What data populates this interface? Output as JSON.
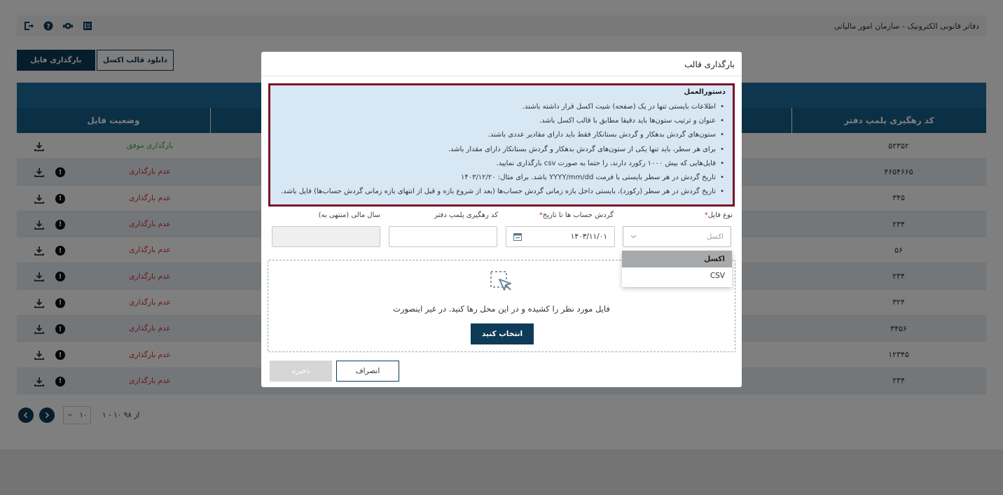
{
  "header": {
    "title": "دفاتر قانونی الکترونیک - سازمان امور مالیاتی",
    "icons": [
      "logout-icon",
      "help-icon",
      "support-icon",
      "book-icon"
    ]
  },
  "actions": {
    "upload_label": "بارگذاری فایل",
    "download_template_label": "دانلود قالب اکسل"
  },
  "table": {
    "columns": [
      "کد رهگیری پلمپ دفتر",
      "",
      "وضعیت فایل"
    ],
    "rows": [
      {
        "code": "۵۲۳۵۲",
        "status": "بارگذاری موفق",
        "status_type": "ok"
      },
      {
        "code": "۴۶۵۴۶۶۵",
        "status": "عدم بارگذاری",
        "status_type": "fail"
      },
      {
        "code": "۳۴۵",
        "status": "عدم بارگذاری",
        "status_type": "fail"
      },
      {
        "code": "۲۳۴",
        "status": "عدم بارگذاری",
        "status_type": "fail"
      },
      {
        "code": "۵۶",
        "status": "عدم بارگذاری",
        "status_type": "fail"
      },
      {
        "code": "۲۳۴",
        "status": "عدم بارگذاری",
        "status_type": "fail"
      },
      {
        "code": "۳۲۴",
        "status": "عدم بارگذاری",
        "status_type": "fail"
      },
      {
        "code": "۳۴۵۶",
        "status": "عدم بارگذاری",
        "status_type": "fail"
      },
      {
        "code": "۱۲۳۴۵",
        "status": "عدم بارگذاری",
        "status_type": "fail"
      },
      {
        "code": "۲۳۴",
        "status": "عدم بارگذاری",
        "status_type": "fail"
      }
    ]
  },
  "pager": {
    "page_size": "۱۰",
    "info": "۱ - ۱۰ از ۹۸"
  },
  "modal": {
    "title": "بارگذاری قالب",
    "instructions_title": "دستورالعمل",
    "instructions": [
      "اطلاعات بایستی تنها در یک (صفحه) شیت اکسل قرار داشته باشند.",
      "عنوان و ترتیب ستون‌ها باید دقیقا مطابق با قالب اکسل باشد.",
      "ستون‌های گردش بدهکار و گردش بستانکار فقط باید دارای مقادیر عددی باشند.",
      "برای هر سطر، باید تنها یکی از ستون‌های گردش بدهکار و گردش بستانکار دارای مقدار باشد.",
      "فایل‌هایی که بیش ۱۰۰۰ رکورد دارند، را حتما به صورت csv بارگذاری نمایید.",
      "تاریخ گردش در هر سطر بایستی با فرمت YYYY/mm/dd باشد. برای مثال: ۱۴۰۳/۱۲/۲۰",
      "تاریخ گردش در هر سطر (رکورد)، بایستی داخل بازه زمانی گردش حساب‌ها (بعد از شروع بازه و قبل از انتهای بازه زمانی گردش حساب‌ها) فایل باشد."
    ],
    "fields": {
      "file_type_label": "نوع فایل",
      "file_type_value": "اکسل",
      "date_label": "گردش حساب ها تا تاریخ",
      "date_value": "۱۴۰۳/۱۱/۰۱",
      "tracking_label": "کد رهگیری پلمپ دفتر",
      "tracking_value": "",
      "fiscal_year_label": "سال مالی (منتهی به)",
      "fiscal_year_value": ""
    },
    "file_type_options": [
      "اکسل",
      "CSV"
    ],
    "drop_text": "فایل مورد نظر را کشیده و در این محل رها کنید. در غیر اینصورت",
    "choose_label": "انتخاب کنید",
    "cancel_label": "انصراف",
    "save_label": "ذخیره"
  },
  "colors": {
    "primary": "#0d3b58",
    "table_header": "#175f89",
    "instructions_bg": "#d8e7f4",
    "instructions_border": "#7a1428",
    "success": "#3ea83e",
    "error": "#d62a2a"
  }
}
